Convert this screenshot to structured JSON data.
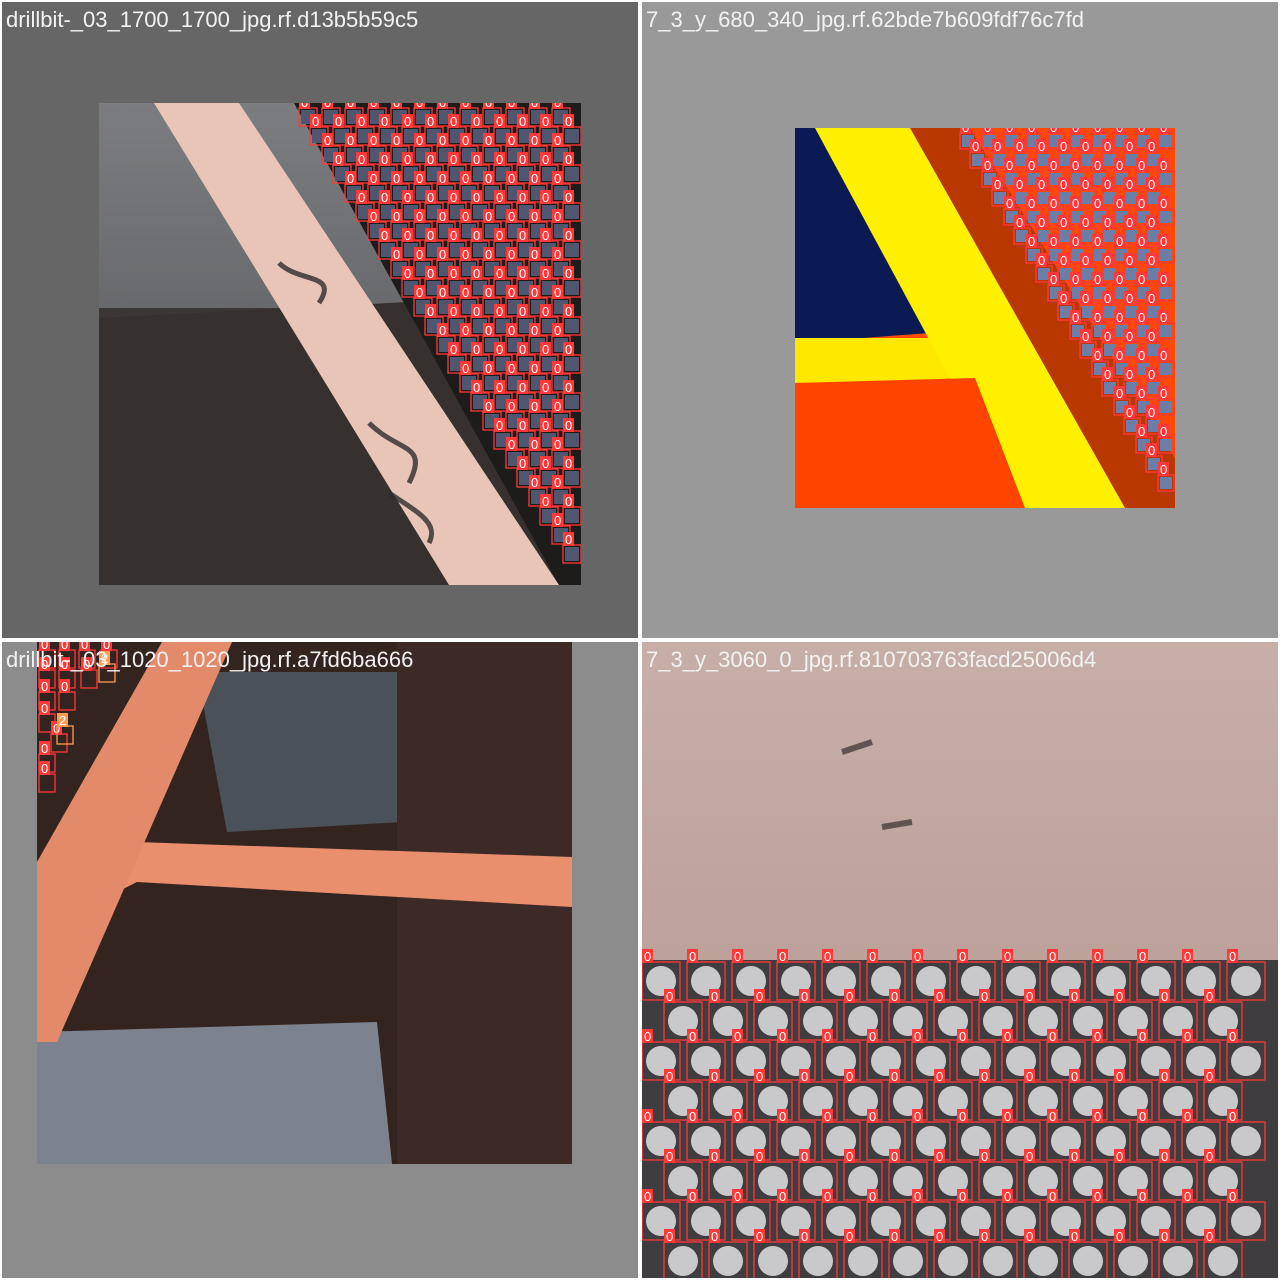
{
  "mosaic": {
    "tiles": [
      {
        "id": "top-left",
        "filename": "drillbit-_03_1700_1700_jpg.rf.d13b5b59c5",
        "background": "#666666"
      },
      {
        "id": "top-right",
        "filename": "7_3_y_680_340_jpg.rf.62bde7b609fdf76c7fd",
        "background": "#999999"
      },
      {
        "id": "bottom-left",
        "filename": "drillbit-_03_1020_1020_jpg.rf.a7fd6ba666",
        "background": "#8c8c8c"
      },
      {
        "id": "bottom-right",
        "filename": "7_3_y_3060_0_jpg.rf.810703763facd25006d4",
        "background": "#a8a09e"
      }
    ]
  },
  "detection_labels": {
    "class_0": "0",
    "class_2": "2"
  },
  "colors": {
    "class_0": "#ff3838",
    "class_2": "#ff9d52",
    "label_text": "#ffffff"
  }
}
